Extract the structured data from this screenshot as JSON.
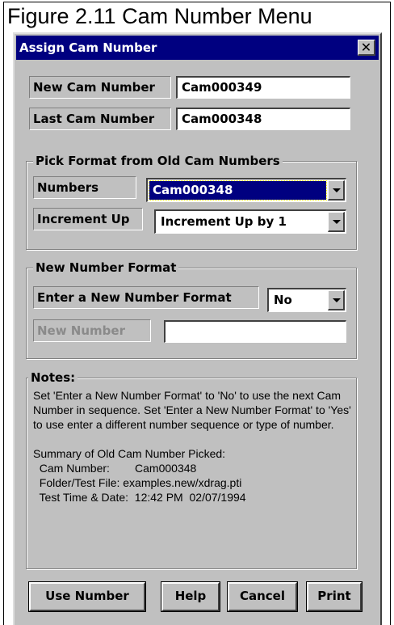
{
  "figure_title": "Figure 2.11 Cam Number Menu",
  "window": {
    "title": "Assign Cam Number",
    "close_glyph": "✕"
  },
  "fields": {
    "new_cam_number": {
      "label": "New Cam Number",
      "value": "Cam000349"
    },
    "last_cam_number": {
      "label": "Last Cam Number",
      "value": "Cam000348"
    }
  },
  "pick_format": {
    "title": "Pick Format from Old Cam Numbers",
    "numbers": {
      "label": "Numbers",
      "value": "Cam000348"
    },
    "increment": {
      "label": "Increment Up",
      "value": "Increment Up by 1"
    }
  },
  "new_format": {
    "title": "New Number Format",
    "enter_label": "Enter a New Number Format",
    "enter_value": "No",
    "new_number_label": "New Number",
    "new_number_value": ""
  },
  "notes": {
    "title": "Notes:",
    "text": "Set 'Enter a New Number Format' to 'No' to use the next Cam Number in sequence.  Set 'Enter a New Number Format' to 'Yes' to use enter a different number sequence or type of number.",
    "summary_title": "Summary of Old Cam Number Picked:",
    "summary_lines": [
      "  Cam Number:        Cam000348",
      "  Folder/Test File: examples.new/xdrag.pti",
      "  Test Time & Date:  12:42 PM  02/07/1994"
    ]
  },
  "buttons": {
    "use_number": "Use Number",
    "help": "Help",
    "cancel": "Cancel",
    "print": "Print"
  },
  "colors": {
    "titlebar": "#000080",
    "face": "#c0c0c0",
    "selection": "#000080"
  }
}
